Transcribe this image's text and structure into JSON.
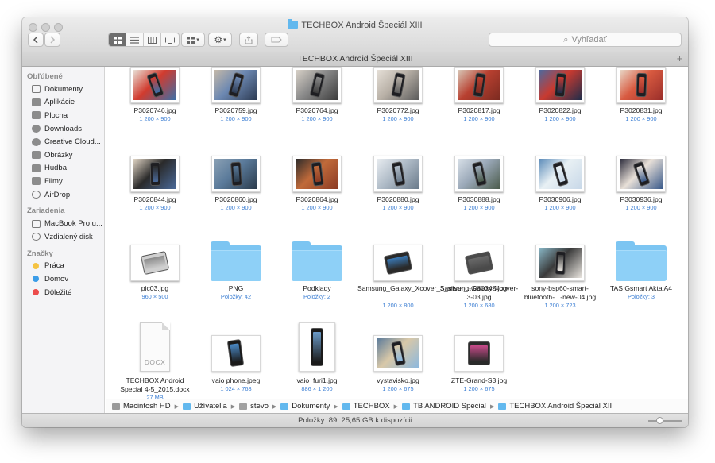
{
  "window": {
    "title": "TECHBOX Android Špeciál XIII",
    "tab_title": "TECHBOX Android Špeciál XIII",
    "search_placeholder": "Vyhľadať"
  },
  "toolbar": {
    "back_icon": "chevron-left-icon",
    "forward_icon": "chevron-right-icon",
    "view_modes": [
      "icon-view-icon",
      "list-view-icon",
      "column-view-icon",
      "coverflow-view-icon"
    ],
    "active_view": "icon-view-icon"
  },
  "sidebar": {
    "sections": [
      {
        "title": "Obľúbené",
        "items": [
          {
            "label": "Dokumenty",
            "icon": "documents-icon"
          },
          {
            "label": "Aplikácie",
            "icon": "applications-icon"
          },
          {
            "label": "Plocha",
            "icon": "desktop-icon"
          },
          {
            "label": "Downloads",
            "icon": "downloads-icon"
          },
          {
            "label": "Creative Cloud...",
            "icon": "creative-cloud-icon"
          },
          {
            "label": "Obrázky",
            "icon": "pictures-icon"
          },
          {
            "label": "Hudba",
            "icon": "music-icon"
          },
          {
            "label": "Filmy",
            "icon": "movies-icon"
          },
          {
            "label": "AirDrop",
            "icon": "airdrop-icon"
          }
        ]
      },
      {
        "title": "Zariadenia",
        "items": [
          {
            "label": "MacBook Pro u...",
            "icon": "laptop-icon"
          },
          {
            "label": "Vzdialený disk",
            "icon": "disc-icon"
          }
        ]
      },
      {
        "title": "Značky",
        "items": [
          {
            "label": "Práca",
            "color": "#f5c342"
          },
          {
            "label": "Domov",
            "color": "#3b9de8"
          },
          {
            "label": "Dôležité",
            "color": "#ec4c4c"
          }
        ]
      }
    ]
  },
  "files": [
    {
      "name": "P3020746.jpg",
      "meta": "1 200 × 900",
      "kind": "photo",
      "colors": [
        "#3a6fa8",
        "#d13b2e",
        "#e8e0d6"
      ]
    },
    {
      "name": "P3020759.jpg",
      "meta": "1 200 × 900",
      "kind": "photo",
      "colors": [
        "#2c3a52",
        "#6c88b2",
        "#c4b8a8"
      ]
    },
    {
      "name": "P3020764.jpg",
      "meta": "1 200 × 900",
      "kind": "photo",
      "colors": [
        "#3b3b3b",
        "#8a8a8a",
        "#d9d2c8"
      ]
    },
    {
      "name": "P3020772.jpg",
      "meta": "1 200 × 900",
      "kind": "photo",
      "colors": [
        "#5a5a5a",
        "#b8b0a6",
        "#e6e0d8"
      ]
    },
    {
      "name": "P3020817.jpg",
      "meta": "1 200 × 900",
      "kind": "photo",
      "colors": [
        "#7a2a20",
        "#b84030",
        "#d8c8b8"
      ]
    },
    {
      "name": "P3020822.jpg",
      "meta": "1 200 × 900",
      "kind": "photo",
      "colors": [
        "#1f2d4a",
        "#c83a30",
        "#4a6aa0"
      ]
    },
    {
      "name": "P3020831.jpg",
      "meta": "1 200 × 900",
      "kind": "photo",
      "colors": [
        "#9a2e2a",
        "#d85a40",
        "#e8d8c8"
      ]
    },
    {
      "name": "P3020844.jpg",
      "meta": "1 200 × 900",
      "kind": "photo",
      "colors": [
        "#4a6a9a",
        "#2a2a2a",
        "#e0d4c4"
      ]
    },
    {
      "name": "P3020860.jpg",
      "meta": "1 200 × 900",
      "kind": "photo",
      "colors": [
        "#2a3a4a",
        "#5a7a9a",
        "#8aa0b4"
      ]
    },
    {
      "name": "P3020864.jpg",
      "meta": "1 200 × 900",
      "kind": "photo",
      "colors": [
        "#8a3a24",
        "#c06a3a",
        "#2a2a2a"
      ]
    },
    {
      "name": "P3020880.jpg",
      "meta": "1 200 × 900",
      "kind": "photo",
      "colors": [
        "#6a7a8a",
        "#b0bcc8",
        "#e8ecf0"
      ]
    },
    {
      "name": "P3030888.jpg",
      "meta": "1 200 × 900",
      "kind": "photo",
      "colors": [
        "#4a5a4a",
        "#9aa8b8",
        "#d8e0e8"
      ]
    },
    {
      "name": "P3030906.jpg",
      "meta": "1 200 × 900",
      "kind": "photo",
      "colors": [
        "#c8d8e8",
        "#e8f0f4",
        "#5a8ab8"
      ]
    },
    {
      "name": "P3030936.jpg",
      "meta": "1 200 × 900",
      "kind": "photo",
      "colors": [
        "#3a5a8a",
        "#e8e0d8",
        "#2a2a3a"
      ]
    },
    {
      "name": "pic03.jpg",
      "meta": "960 × 500",
      "kind": "photo-white",
      "colors": [
        "#cfcfcf",
        "#8a8a8a",
        "#ffffff"
      ]
    },
    {
      "name": "PNG",
      "meta": "Položky: 42",
      "kind": "folder"
    },
    {
      "name": "Podklady",
      "meta": "Položky: 2",
      "kind": "folder"
    },
    {
      "name": "Samsung_Galaxy_Xcover_3_silver_...080348.jpg",
      "meta": "1 200 × 800",
      "kind": "photo-white",
      "colors": [
        "#2a2a2a",
        "#3a7ab8",
        "#ffffff"
      ]
    },
    {
      "name": "Samsung-Galaxy-Xcover-3-03.jpg",
      "meta": "1 200 × 680",
      "kind": "photo-white",
      "colors": [
        "#4a4a4a",
        "#6a6a6a",
        "#ffffff"
      ]
    },
    {
      "name": "sony-bsp60-smart-bluetooth-...-new-04.jpg",
      "meta": "1 200 × 723",
      "kind": "photo",
      "colors": [
        "#e8e4de",
        "#3a3a3a",
        "#8ab8c8"
      ]
    },
    {
      "name": "TAS Gsmart Akta A4",
      "meta": "Položky: 3",
      "kind": "folder"
    },
    {
      "name": "TECHBOX Android Special 4-5_2015.docx",
      "meta": "27 MB",
      "kind": "doc",
      "doc_label": "DOCX"
    },
    {
      "name": "vaio phone.jpeg",
      "meta": "1 024 × 768",
      "kind": "phone",
      "colors": [
        "#1a1a1a",
        "#4a8ac8",
        "#ffffff"
      ]
    },
    {
      "name": "vaio_furi1.jpg",
      "meta": "886 × 1 200",
      "kind": "phone-tall",
      "colors": [
        "#1a1a1a",
        "#6a9ac8",
        "#ffffff"
      ]
    },
    {
      "name": "vystavisko.jpg",
      "meta": "1 200 × 675",
      "kind": "photo",
      "colors": [
        "#8ab8e0",
        "#d8c8a8",
        "#5a7a9a"
      ]
    },
    {
      "name": "ZTE-Grand-S3.jpg",
      "meta": "1 200 × 675",
      "kind": "phone-wide",
      "colors": [
        "#2a2a2a",
        "#c84a8a",
        "#ffffff"
      ]
    }
  ],
  "pathbar": [
    {
      "label": "Macintosh HD",
      "icon": "hard-drive-icon"
    },
    {
      "label": "Užívatelia",
      "icon": "folder-icon"
    },
    {
      "label": "stevo",
      "icon": "home-icon"
    },
    {
      "label": "Dokumenty",
      "icon": "folder-icon"
    },
    {
      "label": "TECHBOX",
      "icon": "folder-icon"
    },
    {
      "label": "TB ANDROID Special",
      "icon": "folder-icon"
    },
    {
      "label": "TECHBOX Android Špeciál XIII",
      "icon": "folder-icon"
    }
  ],
  "status": {
    "text": "Položky: 89, 25,65 GB k dispozícii",
    "zoom_level": 0.35
  }
}
